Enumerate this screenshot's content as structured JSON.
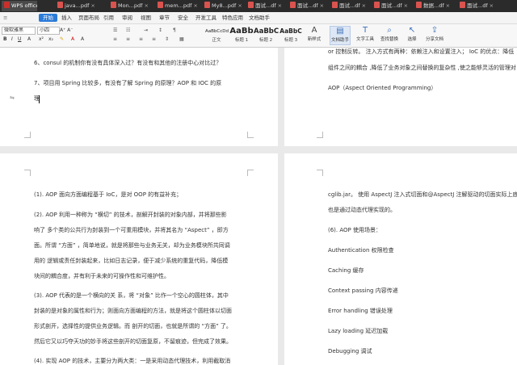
{
  "tabs": [
    {
      "label": "WPS office",
      "active": true
    },
    {
      "label": "java...pdf"
    },
    {
      "label": "Mon...pdf"
    },
    {
      "label": "mem...pdf"
    },
    {
      "label": "My8...pdf"
    },
    {
      "label": "面试...df"
    },
    {
      "label": "面试...df"
    },
    {
      "label": "面试...df"
    },
    {
      "label": "面试...df"
    },
    {
      "label": "数据...df"
    },
    {
      "label": "面试...df"
    }
  ],
  "menu": [
    "开始",
    "插入",
    "页面布局",
    "引用",
    "审阅",
    "视图",
    "章节",
    "安全",
    "开发工具",
    "特色应用",
    "文档助手"
  ],
  "toolbar": {
    "font_name": "微软雅黑",
    "font_size": "小四",
    "styles": [
      {
        "preview": "AaBbCcDd",
        "name": "正文"
      },
      {
        "preview": "AaBb",
        "name": "标题 1"
      },
      {
        "preview": "AaBbC",
        "name": "标题 2"
      },
      {
        "preview": "AaBbC",
        "name": "标题 3"
      }
    ],
    "new_style": "新样式",
    "buttons": [
      {
        "label": "文档助手",
        "icon": "document-assistant-icon"
      },
      {
        "label": "文字工具",
        "icon": "text-tool-icon"
      },
      {
        "label": "查找替换",
        "icon": "find-replace-icon"
      },
      {
        "label": "选择",
        "icon": "select-icon"
      },
      {
        "label": "分享文档",
        "icon": "share-icon"
      }
    ]
  },
  "pages": {
    "top_left": [
      "6、consul 的机制你有没有具体深入过？有没有和其他的注册中心对比过？",
      "7、项目用 Spring 比较多，有没有了解 Spring 的原理？AOP 和 IOC 的原",
      "理"
    ],
    "top_right": [
      "or 控制反转。  注入方式有两种：依赖注入和设置注入；  IoC 的优点：降低",
      "组件之间的耦合 ,降低了业务对象之间替换的复杂性 ,使之能够灵活的管理对",
      "AOP（Aspect Oriented Programming）"
    ],
    "bottom_left": [
      "(1). AOP 面向方面编程基于 IoC，是对 OOP 的有益补充；",
      "(2). AOP 利用一种称为 “横切” 的技术，剖解开封装的对象内部，并将那些影",
      "响了 多个类的公共行为封装到一个可重用模块，并将其名为 “Aspect” ，即方",
      "面。所谓 “方面” ，简单地说，就是将那些与业务无关，却为业务模块所共同调",
      "用的 逻辑或责任封装起来，比如日志记录，便于减少系统的重复代码，降低模",
      "块间的耦合度，并有利于未来的可操作性和可维护性。",
      "(3). AOP 代表的是一个横向的关 系，将 “对象” 比作一个空心的圆柱体，其中",
      "封装的是对象的属性和行为；则面向方面编程的方法，就是将这个圆柱体以切面",
      "形式剖开，选择性的提供业务逻辑。而 剖开的切面，也就是所谓的 “方面” 了。",
      "然后它又以巧夺天功的妙手将这些剖开的切面复原，不留痕迹，但完成了效果。",
      "(4). 实现 AOP 的技术，主要分为两大类：一是采用动态代理技术，利用截取消"
    ],
    "bottom_right": [
      "cglib.jar。    使用 AspectJ 注入式切面和@AspectJ 注解驱动的切面实际上底",
      "也是通过动态代理实现的。",
      "(6). AOP 使用场景：",
      "Authentication  权限检查",
      "Caching  缓存",
      "Context passing  内容传递",
      "Error handling  错误处理",
      "Lazy loading    延迟加载",
      "Debugging  调试"
    ]
  }
}
